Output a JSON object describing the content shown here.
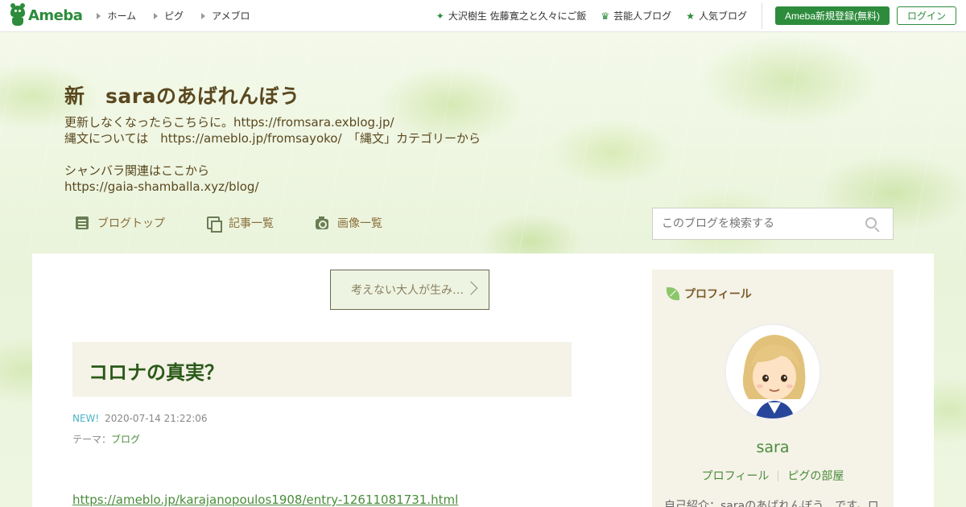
{
  "topbar": {
    "brand": "Ameba",
    "nav": [
      "ホーム",
      "ピグ",
      "アメブロ"
    ],
    "links": [
      {
        "label": "大沢樹生 佐藤寛之と久々にご飯",
        "icon": "sparkle-icon"
      },
      {
        "label": "芸能人ブログ",
        "icon": "crown-icon"
      },
      {
        "label": "人気ブログ",
        "icon": "star-icon"
      }
    ],
    "register_label": "Ameba新規登録(無料)",
    "login_label": "ログイン"
  },
  "blog": {
    "title": "新　saraのあばれんぼう",
    "description": [
      "更新しなくなったらこちらに。https://fromsara.exblog.jp/",
      "縄文については　https://ameblo.jp/fromsayoko/　「縄文」カテゴリーから",
      "",
      "シャンバラ関連はここから",
      "https://gaia-shamballa.xyz/blog/"
    ],
    "nav": {
      "top": "ブログトップ",
      "list": "記事一覧",
      "images": "画像一覧"
    },
    "search_placeholder": "このブログを検索する"
  },
  "entry": {
    "prev_label": "考えない大人が生み…",
    "title": "コロナの真実？",
    "new_badge": "NEW!",
    "date": "2020-07-14 21:22:06",
    "theme_label": "テーマ：",
    "theme": "ブログ",
    "link": "https://ameblo.jp/karajanopoulos1908/entry-12611081731.html"
  },
  "sidebar": {
    "heading": "プロフィール",
    "name": "sara",
    "profile_link": "プロフィール",
    "pig_link": "ピグの部屋",
    "intro": "自己紹介：saraのあばれんぼう、です。ロ"
  },
  "colors": {
    "brand_green": "#2d8c3c",
    "title_brown": "#5a4820",
    "link_green": "#4a8c3a"
  }
}
